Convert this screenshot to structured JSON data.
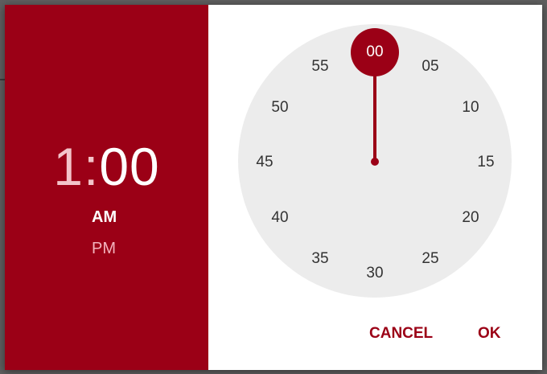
{
  "time_display": {
    "hour": "1",
    "separator": ":",
    "minute": "00"
  },
  "period": {
    "am_label": "AM",
    "pm_label": "PM",
    "selected": "AM"
  },
  "clock": {
    "mode": "minutes",
    "selected_value": "00",
    "numbers": [
      "00",
      "05",
      "10",
      "15",
      "20",
      "25",
      "30",
      "35",
      "40",
      "45",
      "50",
      "55"
    ]
  },
  "actions": {
    "cancel_label": "CANCEL",
    "ok_label": "OK"
  },
  "colors": {
    "accent": "#9b0016",
    "clock_face": "#ececec",
    "inactive_text": "#f3c4ca"
  }
}
